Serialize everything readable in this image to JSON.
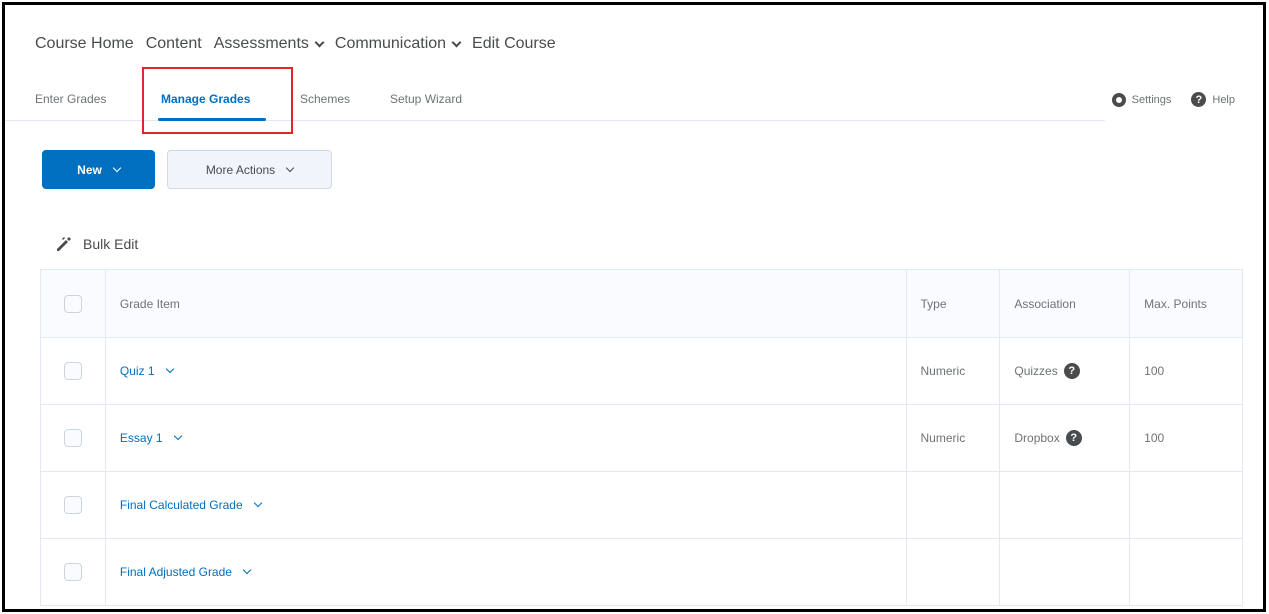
{
  "topnav": {
    "items": [
      {
        "label": "Course Home",
        "has_menu": false
      },
      {
        "label": "Content",
        "has_menu": false
      },
      {
        "label": "Assessments",
        "has_menu": true
      },
      {
        "label": "Communication",
        "has_menu": true
      },
      {
        "label": "Edit Course",
        "has_menu": false
      }
    ]
  },
  "subtabs": {
    "items": [
      "Enter Grades",
      "Manage Grades",
      "Schemes",
      "Setup Wizard"
    ],
    "active": "Manage Grades"
  },
  "tools": {
    "settings_label": "Settings",
    "help_label": "Help",
    "settings_icon": "gear-icon",
    "help_icon": "help-icon"
  },
  "actions": {
    "new_label": "New",
    "more_actions_label": "More Actions"
  },
  "bulk_edit": {
    "label": "Bulk Edit",
    "icon": "pencil-icon"
  },
  "table": {
    "headers": [
      "Grade Item",
      "Type",
      "Association",
      "Max. Points"
    ],
    "rows": [
      {
        "item": "Quiz 1",
        "type": "Numeric",
        "association": "Quizzes",
        "max_points": "100"
      },
      {
        "item": "Essay 1",
        "type": "Numeric",
        "association": "Dropbox",
        "max_points": "100"
      },
      {
        "item": "Final Calculated Grade",
        "type": "",
        "association": "",
        "max_points": ""
      },
      {
        "item": "Final Adjusted Grade",
        "type": "",
        "association": "",
        "max_points": ""
      }
    ]
  },
  "colors": {
    "accent": "#006fbf",
    "highlight": "#e3262a",
    "text": "#494c4e"
  }
}
